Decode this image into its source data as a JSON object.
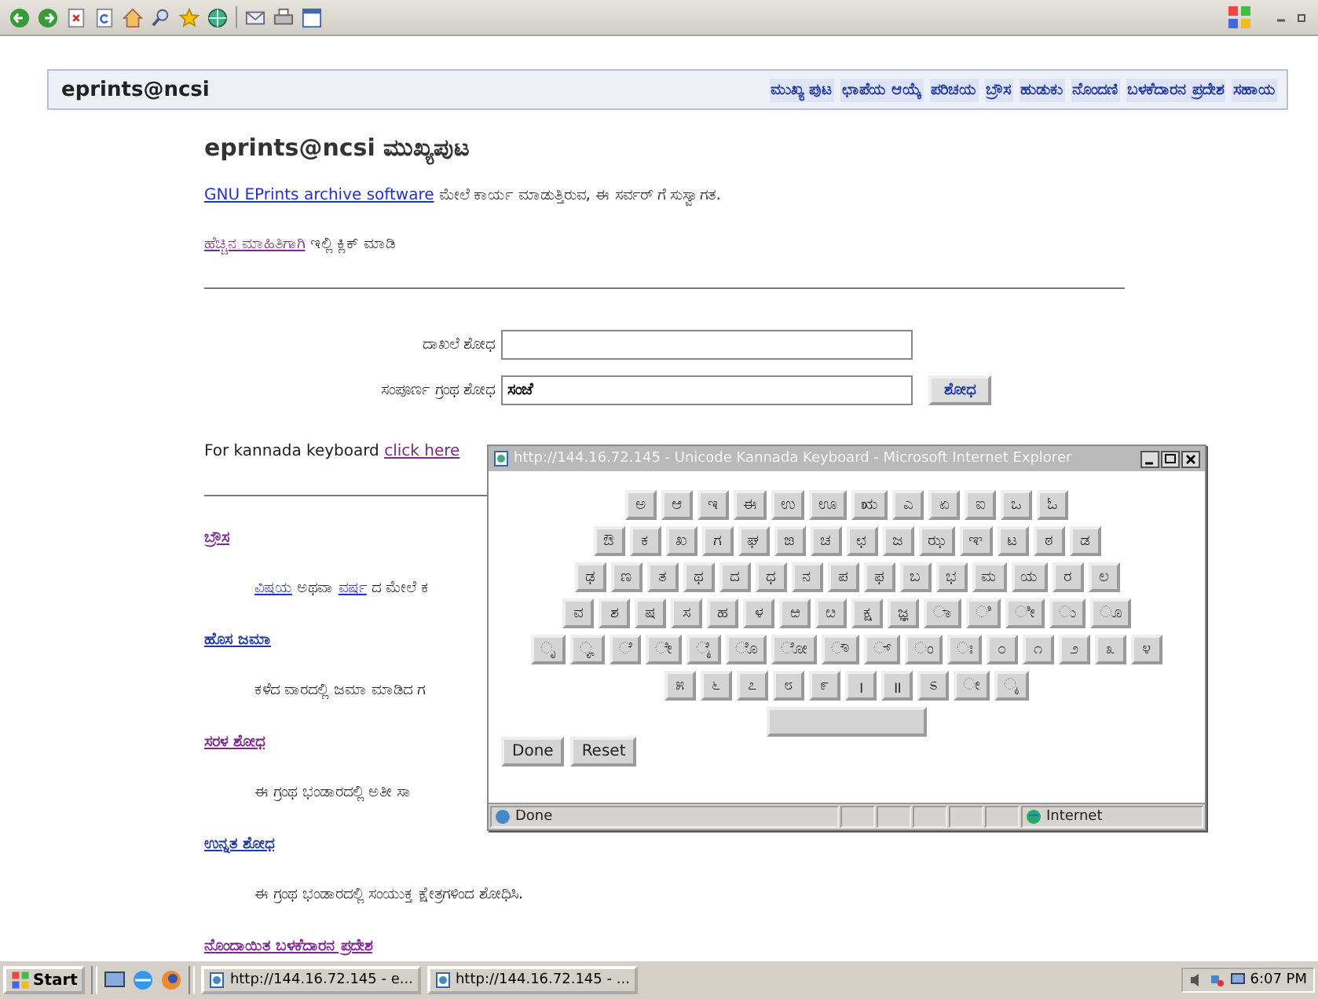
{
  "header": {
    "site": "eprints@ncsi",
    "nav": [
      "ಮುಖ್ಯ ಪುಟ",
      "ಛಾಪೆಯ ಆಯ್ಕೆ",
      "ಪರಿಚಯ",
      "ಬ್ರೌಸ",
      "ಹುಡುಕು",
      "ನೊಂದಣಿ",
      "ಬಳಕೆದಾರನ ಪ್ರದೇಶ",
      "ಸಹಾಯ"
    ]
  },
  "page": {
    "title": "eprints@ncsi ಮುಖ್ಯಪುಟ",
    "welcome": {
      "link": "GNU EPrints archive software",
      "text": "ಮೇಲೆ ಕಾರ್ಯ ಮಾಡುತ್ತಿರುವ, ಈ ಸರ್ವರ್ ಗೆ ಸುಸ್ವಾಗತ."
    },
    "more_info": {
      "link": "ಹೆಚ್ಚಿನ ಮಾಹಿತಿಗಾಗಿ",
      "text": "ಇಲ್ಲಿ ಕ್ಲಿಕ್ ಮಾಡಿ"
    },
    "search": [
      {
        "label": "ದಾಖಲೆ ಶೋಧ"
      },
      {
        "label": "ಸಂಪೂರ್ಣ ಗ್ರಂಥ ಶೋಧ",
        "value": "ಸಂಜೆ"
      }
    ],
    "search_button": "ಶೋಧ",
    "keyboard": {
      "text": "For kannada keyboard",
      "link": "click here"
    },
    "sections": [
      {
        "title": "ಬ್ರೌಸ",
        "description": [
          {
            "kind": "link",
            "text": "ವಿಷಯ"
          },
          {
            "kind": "text",
            "text": "ಅಥವಾ"
          },
          {
            "kind": "link",
            "text": "ವರ್ಷ"
          },
          {
            "kind": "text",
            "text": "ದ ಮೇಲೆ ಕ"
          }
        ]
      },
      {
        "title": "ಹೊಸ ಜಮಾ",
        "description": [
          {
            "kind": "text",
            "text": "ಕಳೆದ ವಾರದಲ್ಲಿ ಜಮಾ ಮಾಡಿದ ಗ"
          }
        ]
      },
      {
        "title": "ಸರಳ ಶೋಧ",
        "description": [
          {
            "kind": "text",
            "text": "ಈ ಗ್ರಂಥ ಭಂಡಾರದಲ್ಲಿ ಅತೀ ಸಾ"
          }
        ]
      },
      {
        "title": "ಉನ್ನತ ಶೋಧ",
        "description": [
          {
            "kind": "text",
            "text": "ಈ ಗ್ರಂಥ ಭಂಡಾರದಲ್ಲಿ ಸಂಯುಕ್ತ ಕ್ಷೇತ್ರಗಳಿಂದ ಶೋಧಿಸಿ."
          }
        ]
      },
      {
        "title": "ನೊಂದಾಯಿತ ಬಳಕೆದಾರನ ಪ್ರದೇಶ"
      }
    ]
  },
  "popup": {
    "title": "http://144.16.72.145 - Unicode Kannada Keyboard - Microsoft Internet Explorer",
    "rows": [
      [
        "ಅ",
        "ಆ",
        "ಇ",
        "ಈ",
        "ಉ",
        "ಊ",
        "ಋ",
        "ಎ",
        "ಏ",
        "ಐ",
        "ಒ",
        "ಓ"
      ],
      [
        "ಔ",
        "ಕ",
        "ಖ",
        "ಗ",
        "ಘ",
        "ಙ",
        "ಚ",
        "ಛ",
        "ಜ",
        "ಝ",
        "ಞ",
        "ಟ",
        "ಠ",
        "ಡ"
      ],
      [
        "ಢ",
        "ಣ",
        "ತ",
        "ಥ",
        "ದ",
        "ಧ",
        "ನ",
        "ಪ",
        "ಫ",
        "ಬ",
        "ಭ",
        "ಮ",
        "ಯ",
        "ರ",
        "ಲ"
      ],
      [
        "ವ",
        "ಶ",
        "ಷ",
        "ಸ",
        "ಹ",
        "ಳ",
        "ಱ",
        "ೞ",
        "ಕ್ಷ",
        "ಜ್ಞ",
        "ಾ",
        "ಿ",
        "ೀ",
        "ು",
        "ೂ"
      ],
      [
        "ೃ",
        "ೄ",
        "ೆ",
        "ೇ",
        "ೈ",
        "ೊ",
        "ೋ",
        "ೌ",
        "್",
        "ಂ",
        "ಃ",
        "೦",
        "೧",
        "೨",
        "೩",
        "೪"
      ],
      [
        "೫",
        "೬",
        "೭",
        "೮",
        "೯",
        "।",
        "॥",
        "ಽ",
        "ೕ",
        "ೖ"
      ]
    ],
    "buttons": [
      "Done",
      "Reset"
    ],
    "status": "Done",
    "zone": "Internet"
  },
  "taskbar": {
    "start": "Start",
    "tasks": [
      "http://144.16.72.145 - e...",
      "http://144.16.72.145 - ..."
    ],
    "clock": "6:07 PM"
  }
}
